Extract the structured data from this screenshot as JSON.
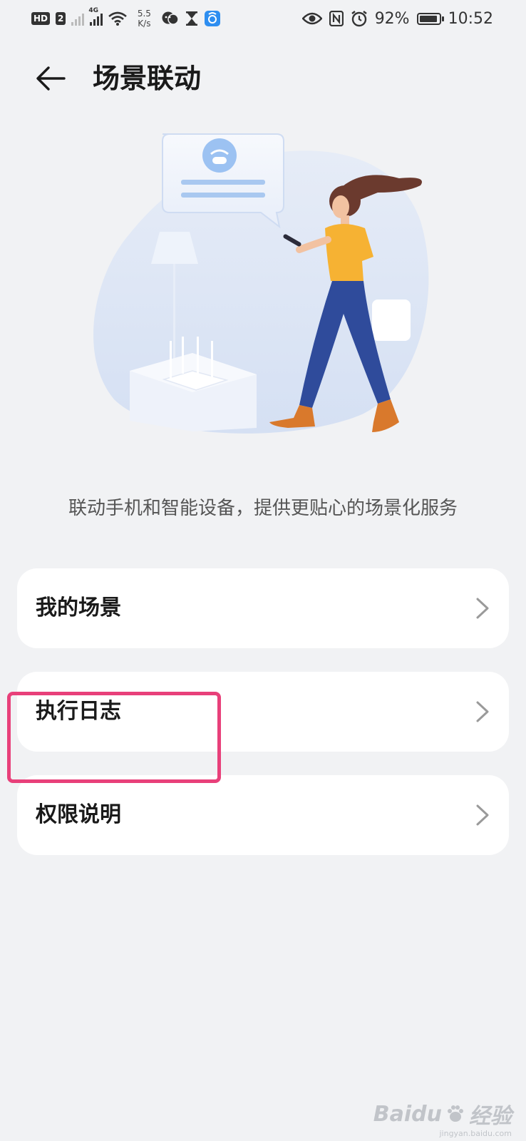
{
  "status_bar": {
    "hd_badge": "HD",
    "sim_badge": "2",
    "network_type": "4G",
    "net_speed_value": "5.5",
    "net_speed_unit": "K/s",
    "battery_percent": "92%",
    "battery_level": 0.92,
    "time": "10:52",
    "icons": [
      "signal-icon",
      "wifi-icon",
      "chat-icon",
      "hourglass-icon",
      "app-icon",
      "eye-icon",
      "nfc-icon",
      "alarm-icon",
      "battery-icon"
    ]
  },
  "header": {
    "title": "场景联动",
    "back_icon": "back-arrow-icon"
  },
  "hero": {
    "subtitle": "联动手机和智能设备，提供更贴心的场景化服务"
  },
  "menu": {
    "items": [
      {
        "label": "我的场景",
        "icon": "chevron-right-icon"
      },
      {
        "label": "执行日志",
        "icon": "chevron-right-icon"
      },
      {
        "label": "权限说明",
        "icon": "chevron-right-icon"
      }
    ]
  },
  "annotation": {
    "highlight_color": "#e8407a"
  },
  "watermark": {
    "brand": "Baidu",
    "brand_cn": "经验",
    "url": "jingyan.baidu.com"
  },
  "colors": {
    "background": "#f1f2f4",
    "card": "#ffffff",
    "title": "#1a1a1a",
    "subtitle": "#555555",
    "chevron": "#9a9a9a"
  }
}
